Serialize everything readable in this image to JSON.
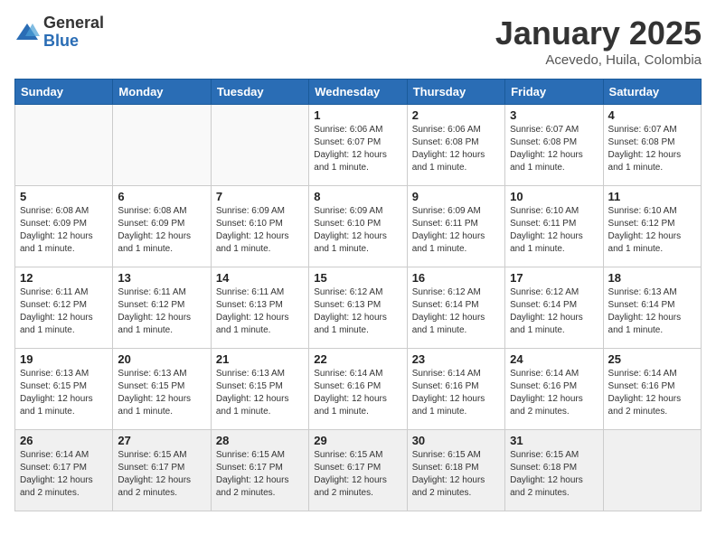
{
  "logo": {
    "general": "General",
    "blue": "Blue"
  },
  "title": "January 2025",
  "subtitle": "Acevedo, Huila, Colombia",
  "days_of_week": [
    "Sunday",
    "Monday",
    "Tuesday",
    "Wednesday",
    "Thursday",
    "Friday",
    "Saturday"
  ],
  "weeks": [
    [
      {
        "day": "",
        "sunrise": "",
        "sunset": "",
        "daylight": "",
        "empty": true
      },
      {
        "day": "",
        "sunrise": "",
        "sunset": "",
        "daylight": "",
        "empty": true
      },
      {
        "day": "",
        "sunrise": "",
        "sunset": "",
        "daylight": "",
        "empty": true
      },
      {
        "day": "1",
        "sunrise": "Sunrise: 6:06 AM",
        "sunset": "Sunset: 6:07 PM",
        "daylight": "Daylight: 12 hours and 1 minute."
      },
      {
        "day": "2",
        "sunrise": "Sunrise: 6:06 AM",
        "sunset": "Sunset: 6:08 PM",
        "daylight": "Daylight: 12 hours and 1 minute."
      },
      {
        "day": "3",
        "sunrise": "Sunrise: 6:07 AM",
        "sunset": "Sunset: 6:08 PM",
        "daylight": "Daylight: 12 hours and 1 minute."
      },
      {
        "day": "4",
        "sunrise": "Sunrise: 6:07 AM",
        "sunset": "Sunset: 6:08 PM",
        "daylight": "Daylight: 12 hours and 1 minute."
      }
    ],
    [
      {
        "day": "5",
        "sunrise": "Sunrise: 6:08 AM",
        "sunset": "Sunset: 6:09 PM",
        "daylight": "Daylight: 12 hours and 1 minute."
      },
      {
        "day": "6",
        "sunrise": "Sunrise: 6:08 AM",
        "sunset": "Sunset: 6:09 PM",
        "daylight": "Daylight: 12 hours and 1 minute."
      },
      {
        "day": "7",
        "sunrise": "Sunrise: 6:09 AM",
        "sunset": "Sunset: 6:10 PM",
        "daylight": "Daylight: 12 hours and 1 minute."
      },
      {
        "day": "8",
        "sunrise": "Sunrise: 6:09 AM",
        "sunset": "Sunset: 6:10 PM",
        "daylight": "Daylight: 12 hours and 1 minute."
      },
      {
        "day": "9",
        "sunrise": "Sunrise: 6:09 AM",
        "sunset": "Sunset: 6:11 PM",
        "daylight": "Daylight: 12 hours and 1 minute."
      },
      {
        "day": "10",
        "sunrise": "Sunrise: 6:10 AM",
        "sunset": "Sunset: 6:11 PM",
        "daylight": "Daylight: 12 hours and 1 minute."
      },
      {
        "day": "11",
        "sunrise": "Sunrise: 6:10 AM",
        "sunset": "Sunset: 6:12 PM",
        "daylight": "Daylight: 12 hours and 1 minute."
      }
    ],
    [
      {
        "day": "12",
        "sunrise": "Sunrise: 6:11 AM",
        "sunset": "Sunset: 6:12 PM",
        "daylight": "Daylight: 12 hours and 1 minute."
      },
      {
        "day": "13",
        "sunrise": "Sunrise: 6:11 AM",
        "sunset": "Sunset: 6:12 PM",
        "daylight": "Daylight: 12 hours and 1 minute."
      },
      {
        "day": "14",
        "sunrise": "Sunrise: 6:11 AM",
        "sunset": "Sunset: 6:13 PM",
        "daylight": "Daylight: 12 hours and 1 minute."
      },
      {
        "day": "15",
        "sunrise": "Sunrise: 6:12 AM",
        "sunset": "Sunset: 6:13 PM",
        "daylight": "Daylight: 12 hours and 1 minute."
      },
      {
        "day": "16",
        "sunrise": "Sunrise: 6:12 AM",
        "sunset": "Sunset: 6:14 PM",
        "daylight": "Daylight: 12 hours and 1 minute."
      },
      {
        "day": "17",
        "sunrise": "Sunrise: 6:12 AM",
        "sunset": "Sunset: 6:14 PM",
        "daylight": "Daylight: 12 hours and 1 minute."
      },
      {
        "day": "18",
        "sunrise": "Sunrise: 6:13 AM",
        "sunset": "Sunset: 6:14 PM",
        "daylight": "Daylight: 12 hours and 1 minute."
      }
    ],
    [
      {
        "day": "19",
        "sunrise": "Sunrise: 6:13 AM",
        "sunset": "Sunset: 6:15 PM",
        "daylight": "Daylight: 12 hours and 1 minute."
      },
      {
        "day": "20",
        "sunrise": "Sunrise: 6:13 AM",
        "sunset": "Sunset: 6:15 PM",
        "daylight": "Daylight: 12 hours and 1 minute."
      },
      {
        "day": "21",
        "sunrise": "Sunrise: 6:13 AM",
        "sunset": "Sunset: 6:15 PM",
        "daylight": "Daylight: 12 hours and 1 minute."
      },
      {
        "day": "22",
        "sunrise": "Sunrise: 6:14 AM",
        "sunset": "Sunset: 6:16 PM",
        "daylight": "Daylight: 12 hours and 1 minute."
      },
      {
        "day": "23",
        "sunrise": "Sunrise: 6:14 AM",
        "sunset": "Sunset: 6:16 PM",
        "daylight": "Daylight: 12 hours and 1 minute."
      },
      {
        "day": "24",
        "sunrise": "Sunrise: 6:14 AM",
        "sunset": "Sunset: 6:16 PM",
        "daylight": "Daylight: 12 hours and 2 minutes."
      },
      {
        "day": "25",
        "sunrise": "Sunrise: 6:14 AM",
        "sunset": "Sunset: 6:16 PM",
        "daylight": "Daylight: 12 hours and 2 minutes."
      }
    ],
    [
      {
        "day": "26",
        "sunrise": "Sunrise: 6:14 AM",
        "sunset": "Sunset: 6:17 PM",
        "daylight": "Daylight: 12 hours and 2 minutes."
      },
      {
        "day": "27",
        "sunrise": "Sunrise: 6:15 AM",
        "sunset": "Sunset: 6:17 PM",
        "daylight": "Daylight: 12 hours and 2 minutes."
      },
      {
        "day": "28",
        "sunrise": "Sunrise: 6:15 AM",
        "sunset": "Sunset: 6:17 PM",
        "daylight": "Daylight: 12 hours and 2 minutes."
      },
      {
        "day": "29",
        "sunrise": "Sunrise: 6:15 AM",
        "sunset": "Sunset: 6:17 PM",
        "daylight": "Daylight: 12 hours and 2 minutes."
      },
      {
        "day": "30",
        "sunrise": "Sunrise: 6:15 AM",
        "sunset": "Sunset: 6:18 PM",
        "daylight": "Daylight: 12 hours and 2 minutes."
      },
      {
        "day": "31",
        "sunrise": "Sunrise: 6:15 AM",
        "sunset": "Sunset: 6:18 PM",
        "daylight": "Daylight: 12 hours and 2 minutes."
      },
      {
        "day": "",
        "sunrise": "",
        "sunset": "",
        "daylight": "",
        "empty": true
      }
    ]
  ]
}
